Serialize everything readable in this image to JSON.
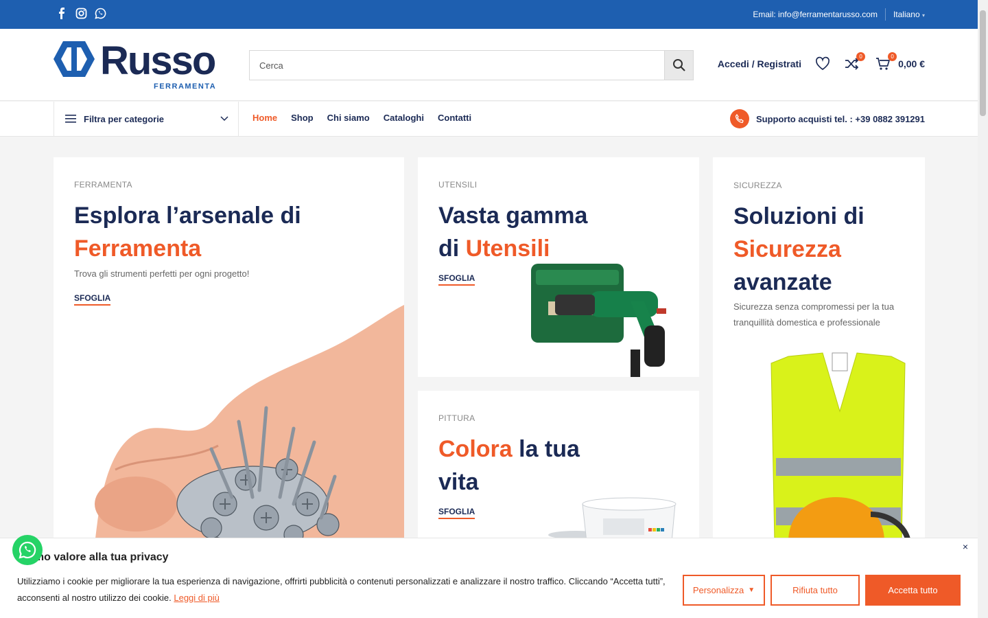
{
  "topbar": {
    "email": "Email: info@ferramentarusso.com",
    "language": "Italiano",
    "social_icons": [
      "facebook-icon",
      "instagram-icon",
      "whatsapp-icon"
    ]
  },
  "header": {
    "logo_text": "Russo",
    "logo_subtext": "FERRAMENTA",
    "search_placeholder": "Cerca",
    "login_label": "Accedi / Registrati",
    "compare_count": "0",
    "cart_count": "0",
    "cart_total": "0,00 €"
  },
  "nav": {
    "category_filter": "Filtra per categorie",
    "items": [
      "Home",
      "Shop",
      "Chi siamo",
      "Cataloghi",
      "Contatti"
    ],
    "active": "Home",
    "support": "Supporto acquisti tel. : +39 0882 391291"
  },
  "cards": [
    {
      "eyebrow": "FERRAMENTA",
      "title_a": "Esplora l’arsenale di",
      "title_hl": "Ferramenta",
      "desc": "Trova gli strumenti perfetti per ogni progetto!",
      "cta": "SFOGLIA"
    },
    {
      "eyebrow": "UTENSILI",
      "title_a": "Vasta gamma",
      "title_b": "di ",
      "title_hl": "Utensili",
      "cta": "SFOGLIA"
    },
    {
      "eyebrow": "SICUREZZA",
      "title_a": "Soluzioni di",
      "title_hl": "Sicurezza",
      "title_b": "avanzate",
      "desc": "Sicurezza senza compromessi per la tua tranquillità domestica e professionale"
    },
    {
      "eyebrow": "PITTURA",
      "title_hl": "Colora",
      "title_a": " la tua",
      "title_b": "vita",
      "cta": "SFOGLIA"
    }
  ],
  "cookie": {
    "title": "Diamo valore alla tua privacy",
    "body": "Utilizziamo i cookie per migliorare la tua esperienza di navigazione, offrirti pubblicità o contenuti personalizzati e analizzare il nostro traffico. Cliccando “Accetta tutti”, acconsenti al nostro utilizzo dei cookie.",
    "link": "Leggi di più",
    "customize": "Personalizza",
    "reject": "Rifiuta tutto",
    "accept": "Accetta tutto",
    "close": "×"
  },
  "colors": {
    "brand_blue": "#1e5fb0",
    "navy": "#1b2a55",
    "accent": "#ef5a28",
    "whatsapp": "#25d366"
  }
}
